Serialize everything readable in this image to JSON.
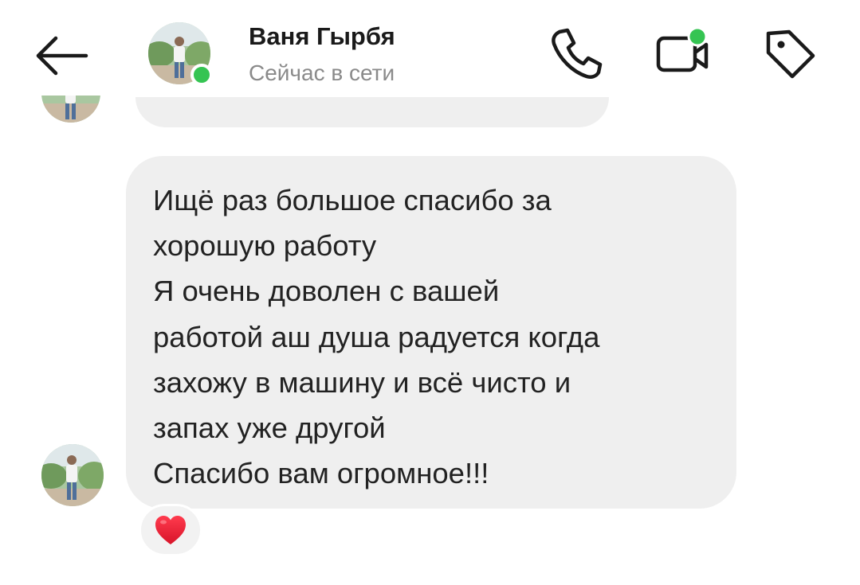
{
  "header": {
    "contact_name": "Ваня Гырбя",
    "status_text": "Сейчас в сети",
    "icons": [
      "back-arrow-icon",
      "phone-icon",
      "video-call-icon",
      "tag-icon"
    ],
    "online_color": "#35c452"
  },
  "message": {
    "text": "Ищё раз большое спасибо за\nхорошую работу\nЯ очень доволен с вашей\nработой аш душа радуется когда\nзахожу в машину и всё чисто и\nзапах уже другой\nСпасибо вам огромное!!!",
    "bubble_color": "#efefef",
    "reaction": "heart"
  }
}
